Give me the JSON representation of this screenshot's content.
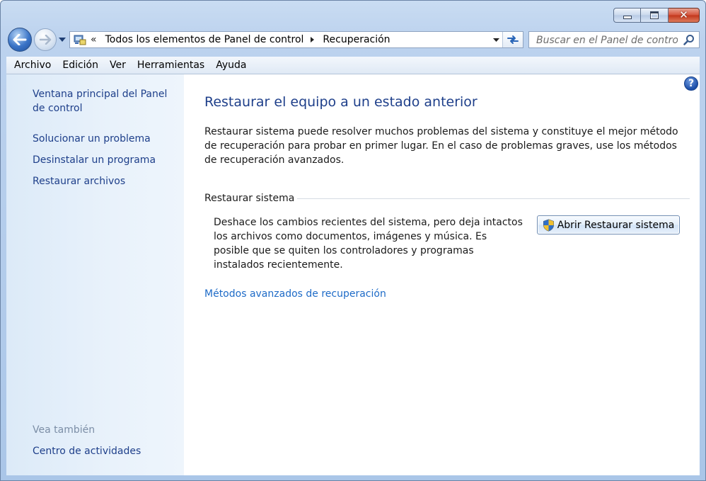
{
  "window": {
    "controls": {
      "minimize": "minimize-icon",
      "maximize": "maximize-icon",
      "close": "close-icon"
    }
  },
  "navigation": {
    "address_overflow": "«",
    "breadcrumbs": [
      "Todos los elementos de Panel de control",
      "Recuperación"
    ],
    "search_placeholder": "Buscar en el Panel de control"
  },
  "menubar": {
    "items": [
      "Archivo",
      "Edición",
      "Ver",
      "Herramientas",
      "Ayuda"
    ]
  },
  "sidebar": {
    "links": [
      "Ventana principal del Panel de control",
      "Solucionar un problema",
      "Desinstalar un programa",
      "Restaurar archivos"
    ],
    "see_also_heading": "Vea también",
    "see_also_links": [
      "Centro de actividades"
    ]
  },
  "main": {
    "title": "Restaurar el equipo a un estado anterior",
    "intro": "Restaurar sistema puede resolver muchos problemas del sistema y constituye el mejor método de recuperación para probar en primer lugar. En el caso de problemas graves, use los métodos de recuperación avanzados.",
    "section_heading": "Restaurar sistema",
    "section_description": "Deshace los cambios recientes del sistema, pero deja intactos los archivos como documentos, imágenes y música. Es posible que se quiten los controladores y programas instalados recientemente.",
    "open_restore_button": "Abrir Restaurar sistema",
    "advanced_link": "Métodos avanzados de recuperación",
    "help_glyph": "?"
  },
  "colors": {
    "link": "#1e3f8a",
    "accent_link": "#1e6bc7",
    "sidebar_bg": "#dceaf8",
    "frame": "#aac6e8"
  }
}
